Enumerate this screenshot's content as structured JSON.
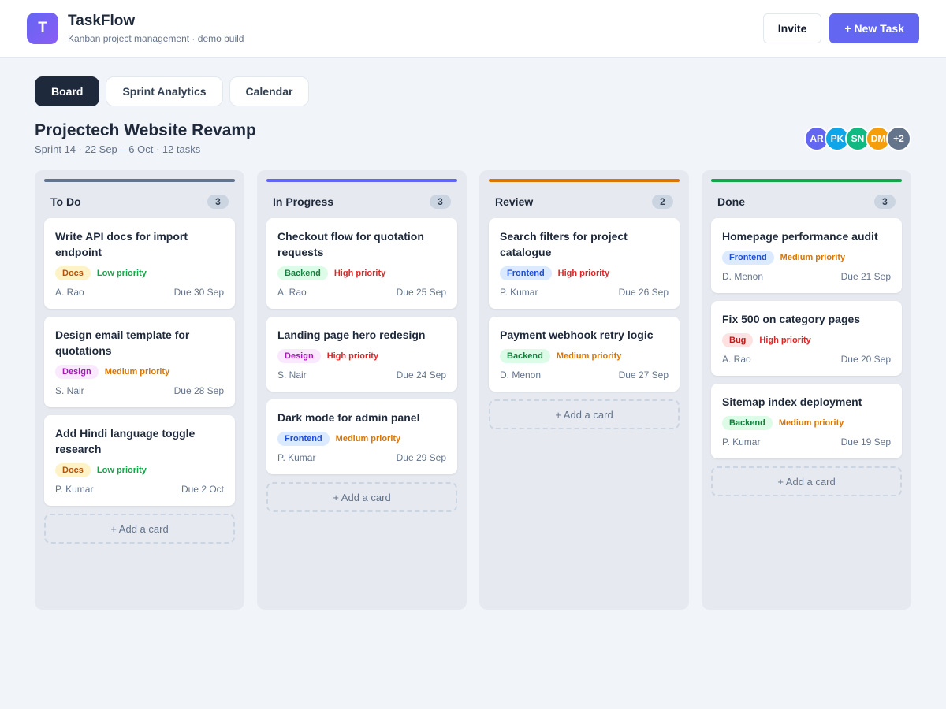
{
  "app": {
    "logo_letter": "T",
    "name": "TaskFlow",
    "subtitle": "Kanban project management · demo build"
  },
  "actions": {
    "invite": "Invite",
    "new_task": "+ New Task"
  },
  "tabs": [
    {
      "label": "Board",
      "active": true
    },
    {
      "label": "Sprint Analytics",
      "active": false
    },
    {
      "label": "Calendar",
      "active": false
    }
  ],
  "project": {
    "title": "Projectech Website Revamp",
    "subtitle": "Sprint 14 · 22 Sep – 6 Oct · 12 tasks"
  },
  "members": [
    {
      "initials": "AR",
      "color": "#6366f1"
    },
    {
      "initials": "PK",
      "color": "#0ea5e9"
    },
    {
      "initials": "SN",
      "color": "#10b981"
    },
    {
      "initials": "DM",
      "color": "#f59e0b"
    },
    {
      "initials": "+2",
      "color": "#64748b"
    }
  ],
  "tag_styles": {
    "Docs": {
      "bg": "#fef3c7",
      "fg": "#b45309"
    },
    "Design": {
      "bg": "#fae8ff",
      "fg": "#a21caf"
    },
    "Backend": {
      "bg": "#dcfce7",
      "fg": "#15803d"
    },
    "Frontend": {
      "bg": "#dbeafe",
      "fg": "#1d4ed8"
    },
    "Bug": {
      "bg": "#fee2e2",
      "fg": "#b91c1c"
    }
  },
  "priority_colors": {
    "Low priority": "#16a34a",
    "Medium priority": "#d97706",
    "High priority": "#dc2626"
  },
  "add_card_label": "+ Add a card",
  "columns": [
    {
      "title": "To Do",
      "count": "3",
      "color": "#64748b",
      "cards": [
        {
          "title": "Write API docs for import endpoint",
          "tag": "Docs",
          "priority": "Low priority",
          "assignee": "A. Rao",
          "due": "Due 30 Sep"
        },
        {
          "title": "Design email template for quotations",
          "tag": "Design",
          "priority": "Medium priority",
          "assignee": "S. Nair",
          "due": "Due 28 Sep"
        },
        {
          "title": "Add Hindi language toggle research",
          "tag": "Docs",
          "priority": "Low priority",
          "assignee": "P. Kumar",
          "due": "Due 2 Oct"
        }
      ]
    },
    {
      "title": "In Progress",
      "count": "3",
      "color": "#6366f1",
      "cards": [
        {
          "title": "Checkout flow for quotation requests",
          "tag": "Backend",
          "priority": "High priority",
          "assignee": "A. Rao",
          "due": "Due 25 Sep"
        },
        {
          "title": "Landing page hero redesign",
          "tag": "Design",
          "priority": "High priority",
          "assignee": "S. Nair",
          "due": "Due 24 Sep"
        },
        {
          "title": "Dark mode for admin panel",
          "tag": "Frontend",
          "priority": "Medium priority",
          "assignee": "P. Kumar",
          "due": "Due 29 Sep"
        }
      ]
    },
    {
      "title": "Review",
      "count": "2",
      "color": "#d97706",
      "cards": [
        {
          "title": "Search filters for project catalogue",
          "tag": "Frontend",
          "priority": "High priority",
          "assignee": "P. Kumar",
          "due": "Due 26 Sep"
        },
        {
          "title": "Payment webhook retry logic",
          "tag": "Backend",
          "priority": "Medium priority",
          "assignee": "D. Menon",
          "due": "Due 27 Sep"
        }
      ]
    },
    {
      "title": "Done",
      "count": "3",
      "color": "#16a34a",
      "cards": [
        {
          "title": "Homepage performance audit",
          "tag": "Frontend",
          "priority": "Medium priority",
          "assignee": "D. Menon",
          "due": "Due 21 Sep"
        },
        {
          "title": "Fix 500 on category pages",
          "tag": "Bug",
          "priority": "High priority",
          "assignee": "A. Rao",
          "due": "Due 20 Sep"
        },
        {
          "title": "Sitemap index deployment",
          "tag": "Backend",
          "priority": "Medium priority",
          "assignee": "P. Kumar",
          "due": "Due 19 Sep"
        }
      ]
    }
  ]
}
